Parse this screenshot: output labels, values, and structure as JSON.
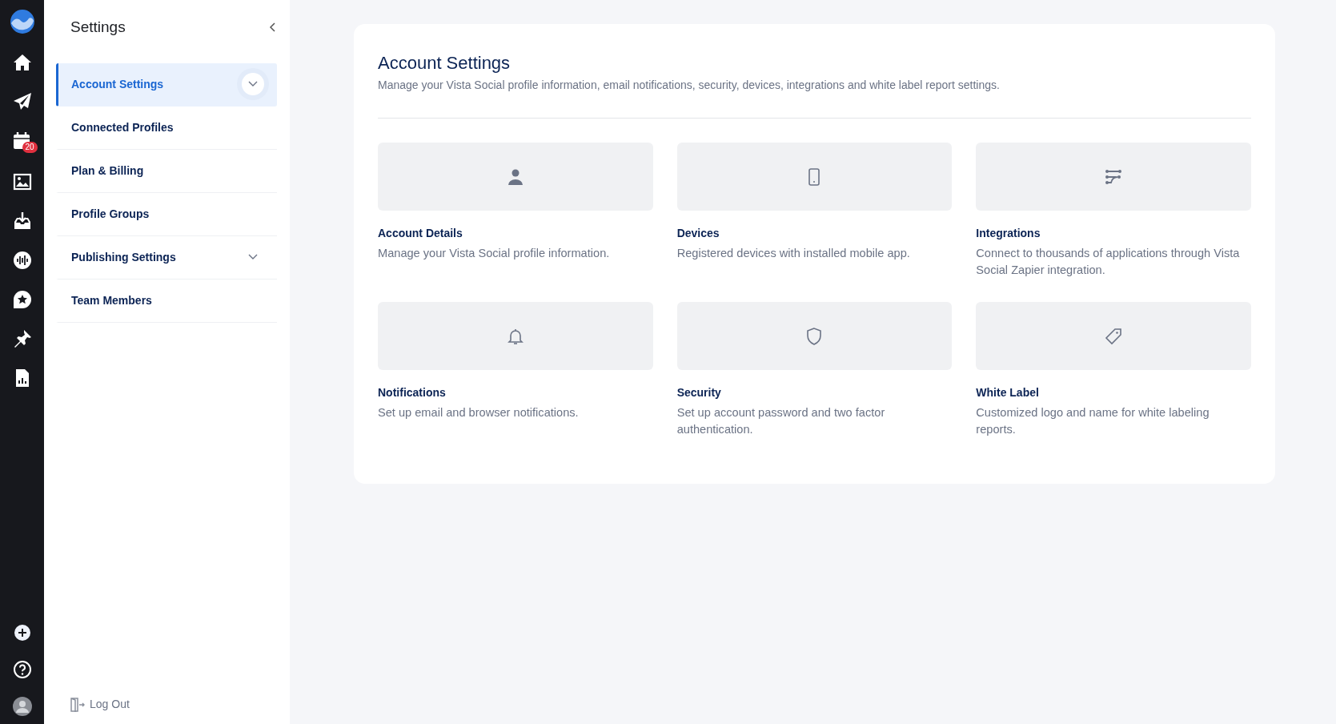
{
  "rail": {
    "calendar_badge": "20"
  },
  "sidebar": {
    "title": "Settings",
    "items": [
      {
        "label": "Account Settings",
        "selected": true,
        "expandable": true
      },
      {
        "label": "Connected Profiles",
        "selected": false,
        "expandable": false
      },
      {
        "label": "Plan & Billing",
        "selected": false,
        "expandable": false
      },
      {
        "label": "Profile Groups",
        "selected": false,
        "expandable": false
      },
      {
        "label": "Publishing Settings",
        "selected": false,
        "expandable": true
      },
      {
        "label": "Team Members",
        "selected": false,
        "expandable": false
      }
    ],
    "logout": "Log Out"
  },
  "main": {
    "title": "Account Settings",
    "subtitle": "Manage your Vista Social profile information, email notifications, security, devices, integrations and white label report settings.",
    "tiles": [
      {
        "kind": "person",
        "title": "Account Details",
        "description": "Manage your Vista Social profile information."
      },
      {
        "kind": "phone",
        "title": "Devices",
        "description": "Registered devices with installed mobile app."
      },
      {
        "kind": "flow",
        "title": "Integrations",
        "description": "Connect to thousands of applications through Vista Social Zapier integration."
      },
      {
        "kind": "bell",
        "title": "Notifications",
        "description": "Set up email and browser notifications."
      },
      {
        "kind": "shield",
        "title": "Security",
        "description": "Set up account password and two factor authentication."
      },
      {
        "kind": "tag",
        "title": "White Label",
        "description": "Customized logo and name for white labeling reports."
      }
    ]
  }
}
